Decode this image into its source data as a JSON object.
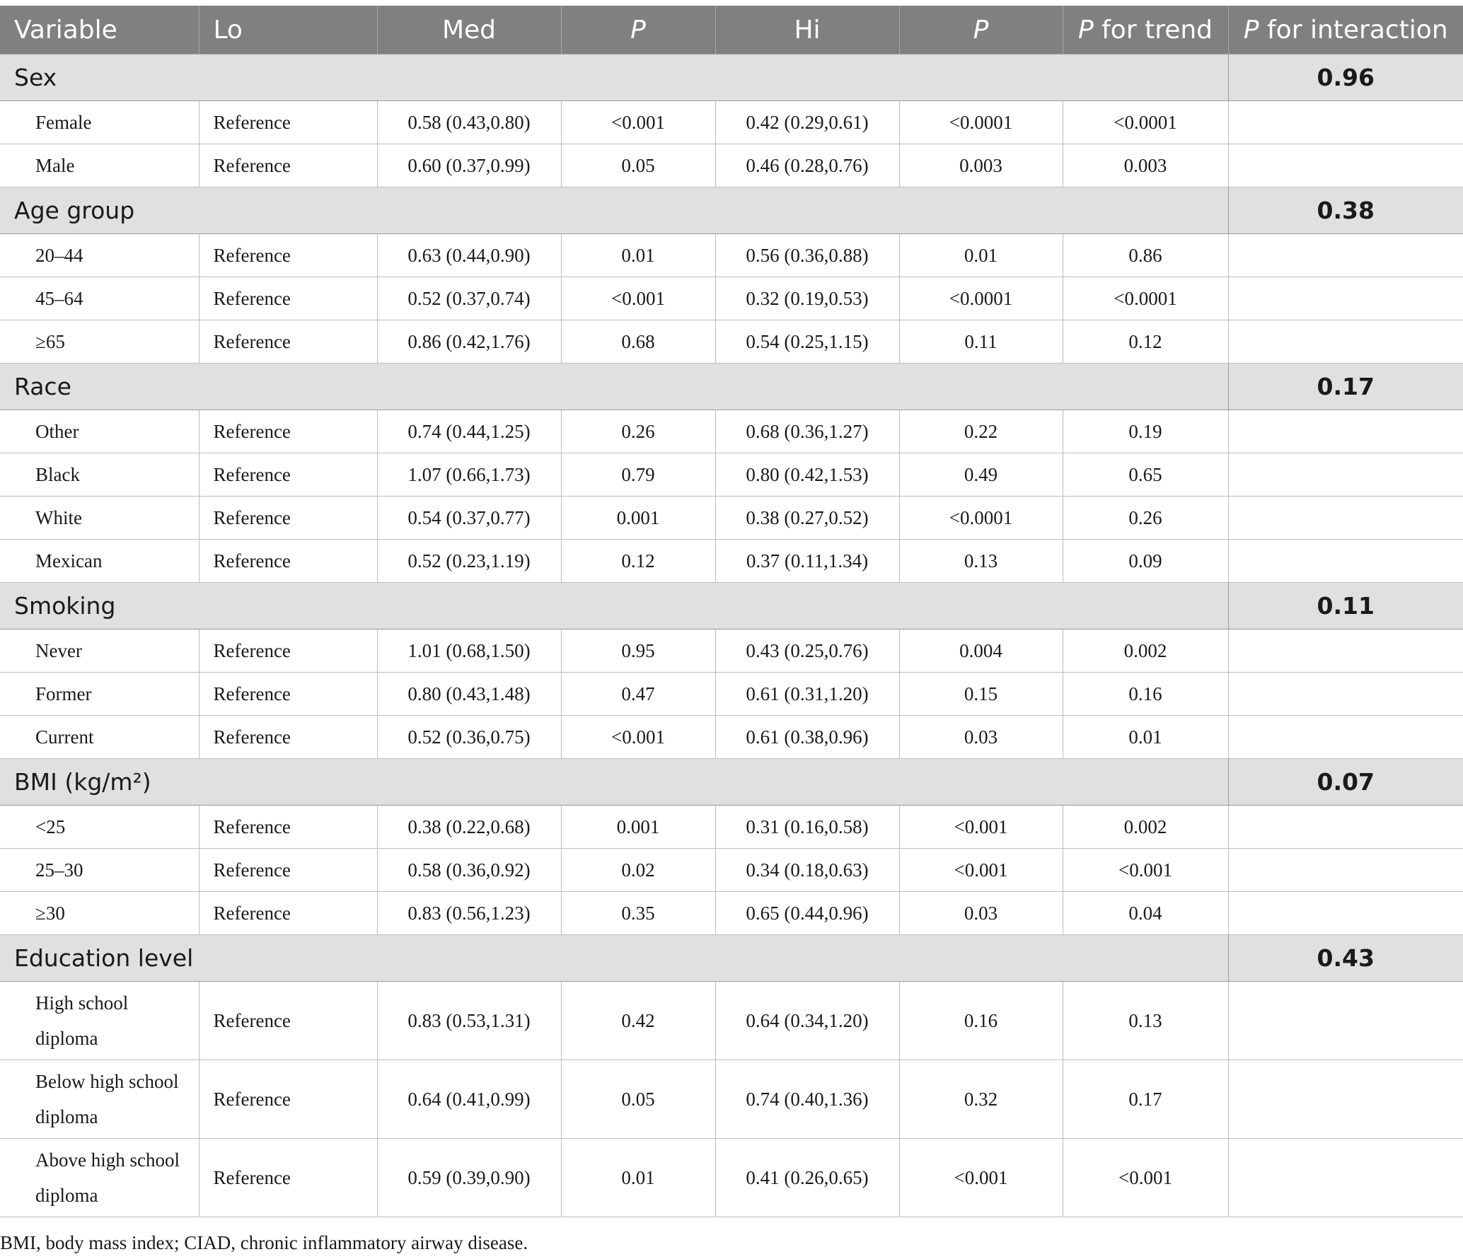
{
  "header": {
    "variable": "Variable",
    "lo": "Lo",
    "med": "Med",
    "p1": "P",
    "hi": "Hi",
    "p2": "P",
    "p_trend_italic": "P",
    "p_trend_rest": " for trend",
    "p_int_italic": "P",
    "p_int_rest": " for interaction"
  },
  "groups": [
    {
      "name": "Sex",
      "interaction": "0.96",
      "rows": [
        {
          "variable": "Female",
          "lo": "Reference",
          "med": "0.58 (0.43,0.80)",
          "p_med": "<0.001",
          "hi": "0.42 (0.29,0.61)",
          "p_hi": "<0.0001",
          "p_trend": "<0.0001"
        },
        {
          "variable": "Male",
          "lo": "Reference",
          "med": "0.60 (0.37,0.99)",
          "p_med": "0.05",
          "hi": "0.46 (0.28,0.76)",
          "p_hi": "0.003",
          "p_trend": "0.003"
        }
      ]
    },
    {
      "name": "Age group",
      "interaction": "0.38",
      "rows": [
        {
          "variable": "20–44",
          "lo": "Reference",
          "med": "0.63 (0.44,0.90)",
          "p_med": "0.01",
          "hi": "0.56 (0.36,0.88)",
          "p_hi": "0.01",
          "p_trend": "0.86"
        },
        {
          "variable": "45–64",
          "lo": "Reference",
          "med": "0.52 (0.37,0.74)",
          "p_med": "<0.001",
          "hi": "0.32 (0.19,0.53)",
          "p_hi": "<0.0001",
          "p_trend": "<0.0001"
        },
        {
          "variable": "≥65",
          "lo": "Reference",
          "med": "0.86 (0.42,1.76)",
          "p_med": "0.68",
          "hi": "0.54 (0.25,1.15)",
          "p_hi": "0.11",
          "p_trend": "0.12"
        }
      ]
    },
    {
      "name": "Race",
      "interaction": "0.17",
      "rows": [
        {
          "variable": "Other",
          "lo": "Reference",
          "med": "0.74 (0.44,1.25)",
          "p_med": "0.26",
          "hi": "0.68 (0.36,1.27)",
          "p_hi": "0.22",
          "p_trend": "0.19"
        },
        {
          "variable": "Black",
          "lo": "Reference",
          "med": "1.07 (0.66,1.73)",
          "p_med": "0.79",
          "hi": "0.80 (0.42,1.53)",
          "p_hi": "0.49",
          "p_trend": "0.65"
        },
        {
          "variable": "White",
          "lo": "Reference",
          "med": "0.54 (0.37,0.77)",
          "p_med": "0.001",
          "hi": "0.38 (0.27,0.52)",
          "p_hi": "<0.0001",
          "p_trend": "0.26"
        },
        {
          "variable": "Mexican",
          "lo": "Reference",
          "med": "0.52 (0.23,1.19)",
          "p_med": "0.12",
          "hi": "0.37 (0.11,1.34)",
          "p_hi": "0.13",
          "p_trend": "0.09"
        }
      ]
    },
    {
      "name": "Smoking",
      "interaction": "0.11",
      "rows": [
        {
          "variable": "Never",
          "lo": "Reference",
          "med": "1.01 (0.68,1.50)",
          "p_med": "0.95",
          "hi": "0.43 (0.25,0.76)",
          "p_hi": "0.004",
          "p_trend": "0.002"
        },
        {
          "variable": "Former",
          "lo": "Reference",
          "med": "0.80 (0.43,1.48)",
          "p_med": "0.47",
          "hi": "0.61 (0.31,1.20)",
          "p_hi": "0.15",
          "p_trend": "0.16"
        },
        {
          "variable": "Current",
          "lo": "Reference",
          "med": "0.52 (0.36,0.75)",
          "p_med": "<0.001",
          "hi": "0.61 (0.38,0.96)",
          "p_hi": "0.03",
          "p_trend": "0.01"
        }
      ]
    },
    {
      "name": "BMI (kg/m²)",
      "interaction": "0.07",
      "rows": [
        {
          "variable": "<25",
          "lo": "Reference",
          "med": "0.38 (0.22,0.68)",
          "p_med": "0.001",
          "hi": "0.31 (0.16,0.58)",
          "p_hi": "<0.001",
          "p_trend": "0.002"
        },
        {
          "variable": "25–30",
          "lo": "Reference",
          "med": "0.58 (0.36,0.92)",
          "p_med": "0.02",
          "hi": "0.34 (0.18,0.63)",
          "p_hi": "<0.001",
          "p_trend": "<0.001"
        },
        {
          "variable": "≥30",
          "lo": "Reference",
          "med": "0.83 (0.56,1.23)",
          "p_med": "0.35",
          "hi": "0.65 (0.44,0.96)",
          "p_hi": "0.03",
          "p_trend": "0.04"
        }
      ]
    },
    {
      "name": "Education level",
      "interaction": "0.43",
      "rows": [
        {
          "variable": "High school diploma",
          "lo": "Reference",
          "med": "0.83 (0.53,1.31)",
          "p_med": "0.42",
          "hi": "0.64 (0.34,1.20)",
          "p_hi": "0.16",
          "p_trend": "0.13",
          "tall": true
        },
        {
          "variable": "Below high school diploma",
          "lo": "Reference",
          "med": "0.64 (0.41,0.99)",
          "p_med": "0.05",
          "hi": "0.74 (0.40,1.36)",
          "p_hi": "0.32",
          "p_trend": "0.17",
          "tall": true
        },
        {
          "variable": "Above high school diploma",
          "lo": "Reference",
          "med": "0.59 (0.39,0.90)",
          "p_med": "0.01",
          "hi": "0.41 (0.26,0.65)",
          "p_hi": "<0.001",
          "p_trend": "<0.001",
          "tall": true
        }
      ]
    }
  ],
  "footnote": "BMI, body mass index; CIAD, chronic inflammatory airway disease."
}
